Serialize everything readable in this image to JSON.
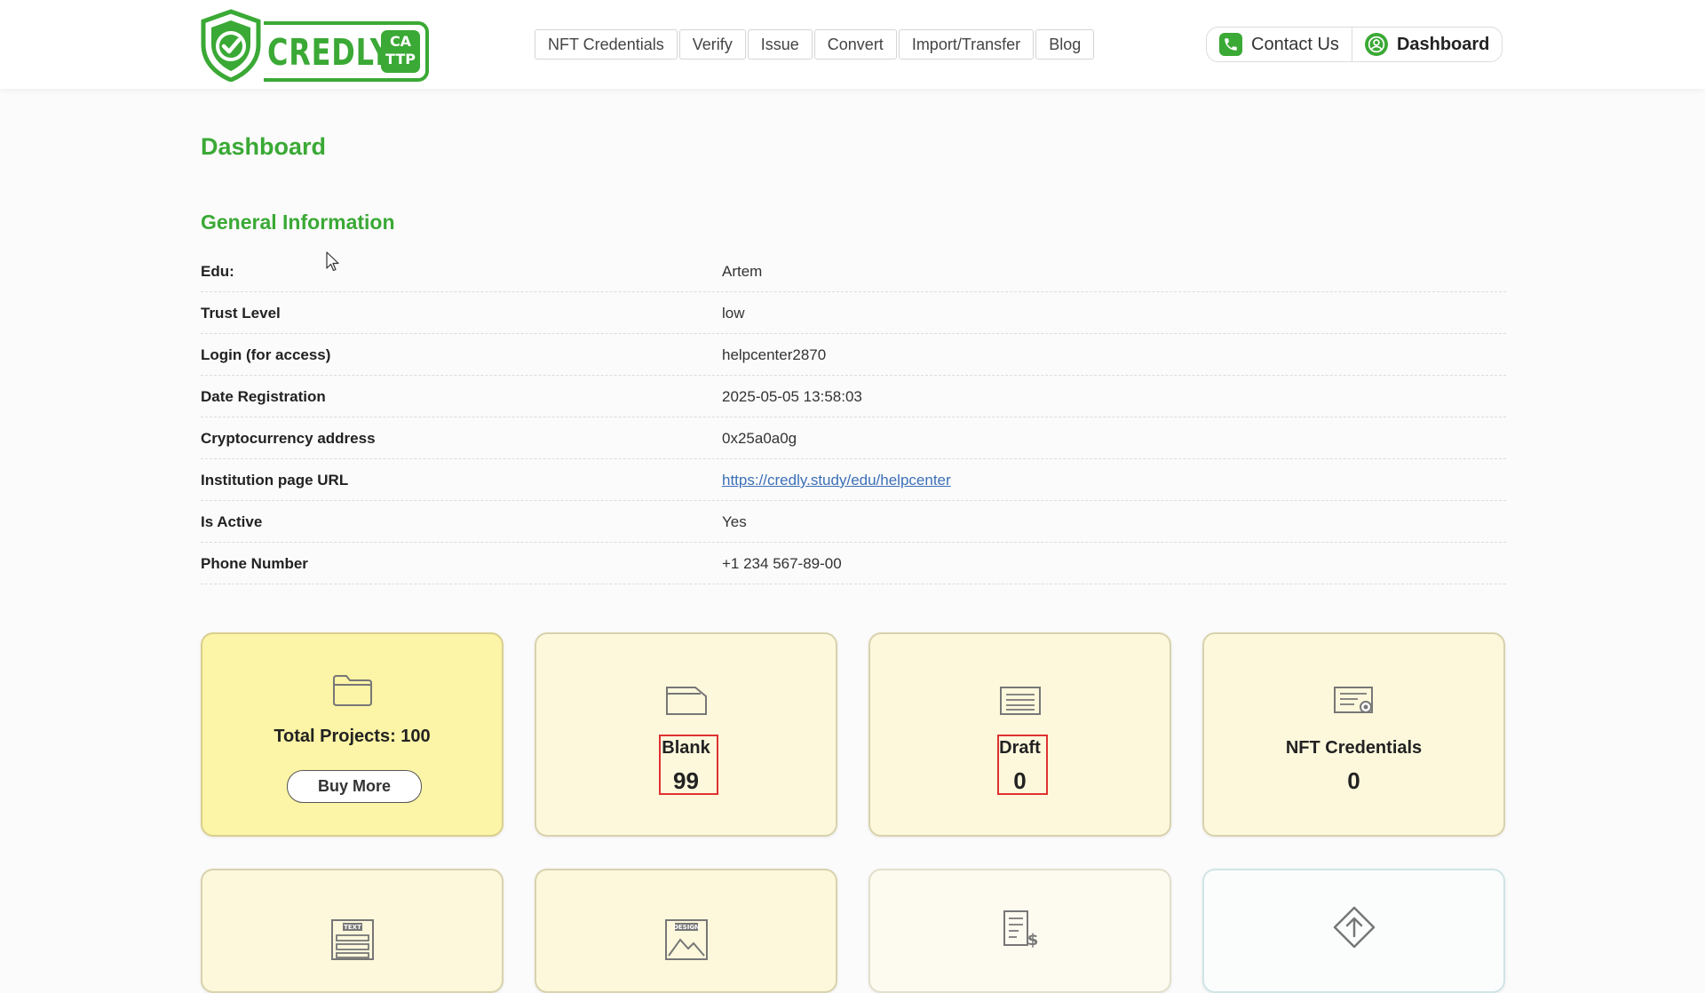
{
  "header": {
    "logo": {
      "word": "CREDLY",
      "badge_line1": "CA",
      "badge_line2": "TTP",
      "icon": "shield-check-icon"
    },
    "nav": [
      {
        "label": "NFT Credentials"
      },
      {
        "label": "Verify"
      },
      {
        "label": "Issue"
      },
      {
        "label": "Convert"
      },
      {
        "label": "Import/Transfer"
      },
      {
        "label": "Blog"
      }
    ],
    "contact_label": "Contact Us",
    "contact_icon": "phone-icon",
    "dashboard_label": "Dashboard",
    "dashboard_icon": "user-icon"
  },
  "page": {
    "title": "Dashboard",
    "section_title": "General Information"
  },
  "info": [
    {
      "label": "Edu:",
      "value": "Artem"
    },
    {
      "label": "Trust Level",
      "value": "low"
    },
    {
      "label": "Login (for access)",
      "value": "helpcenter2870"
    },
    {
      "label": "Date Registration",
      "value": "2025-05-05 13:58:03"
    },
    {
      "label": "Cryptocurrency address",
      "value": "0x25a0a0g"
    },
    {
      "label": "Institution page URL",
      "value": "https://credly.study/edu/helpcenter"
    },
    {
      "label": "Is Active",
      "value": "Yes"
    },
    {
      "label": "Phone Number",
      "value": "+1 234 567-89-00"
    }
  ],
  "cards": {
    "total_projects": {
      "label": "Total Projects: 100",
      "button": "Buy More",
      "icon": "folder-icon"
    },
    "blank": {
      "label": "Blank",
      "value": "99",
      "icon": "blank-document-icon"
    },
    "draft": {
      "label": "Draft",
      "value": "0",
      "icon": "draft-lines-icon"
    },
    "nft_credentials": {
      "label": "NFT Credentials",
      "value": "0",
      "icon": "certificate-icon"
    },
    "text_card": {
      "icon": "text-template-icon",
      "icon_text": "TEXT"
    },
    "design_card": {
      "icon": "design-template-icon",
      "icon_text": "DESIGN"
    },
    "invoice_card": {
      "icon": "invoice-icon"
    },
    "upload_card": {
      "icon": "arrow-up-diamond-icon"
    }
  },
  "colors": {
    "brand_green": "#3aa935",
    "link_blue": "#3b6fb6",
    "highlight_red": "#e03131",
    "card_yellow": "#fcf4a6",
    "card_pale": "#fdf8dc"
  }
}
